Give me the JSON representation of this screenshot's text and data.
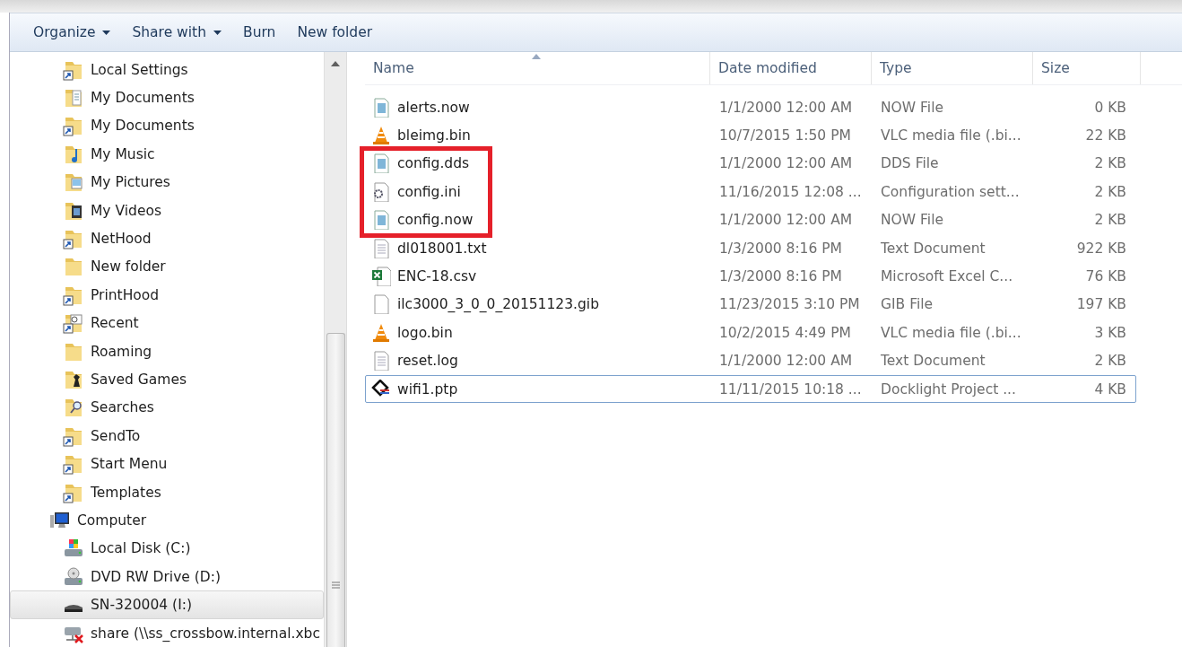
{
  "toolbar": [
    {
      "label": "Organize",
      "dropdown": true
    },
    {
      "label": "Share with",
      "dropdown": true
    },
    {
      "label": "Burn",
      "dropdown": false
    },
    {
      "label": "New folder",
      "dropdown": false
    }
  ],
  "sidebar": {
    "items": [
      {
        "label": "Local Settings",
        "kind": "shortcut",
        "selected": false
      },
      {
        "label": "My Documents",
        "kind": "documents",
        "selected": false
      },
      {
        "label": "My Documents",
        "kind": "shortcut",
        "selected": false
      },
      {
        "label": "My Music",
        "kind": "music",
        "selected": false
      },
      {
        "label": "My Pictures",
        "kind": "pictures",
        "selected": false
      },
      {
        "label": "My Videos",
        "kind": "videos",
        "selected": false
      },
      {
        "label": "NetHood",
        "kind": "shortcut",
        "selected": false
      },
      {
        "label": "New folder",
        "kind": "folder",
        "selected": false
      },
      {
        "label": "PrintHood",
        "kind": "shortcut",
        "selected": false
      },
      {
        "label": "Recent",
        "kind": "recent",
        "selected": false
      },
      {
        "label": "Roaming",
        "kind": "folder",
        "selected": false
      },
      {
        "label": "Saved Games",
        "kind": "games",
        "selected": false
      },
      {
        "label": "Searches",
        "kind": "searches",
        "selected": false
      },
      {
        "label": "SendTo",
        "kind": "shortcut",
        "selected": false
      },
      {
        "label": "Start Menu",
        "kind": "shortcut",
        "selected": false
      },
      {
        "label": "Templates",
        "kind": "shortcut",
        "selected": false
      },
      {
        "label": "Computer",
        "kind": "computer",
        "selected": false,
        "children": [
          {
            "label": "Local Disk (C:)",
            "kind": "disk",
            "selected": false
          },
          {
            "label": "DVD RW Drive (D:)",
            "kind": "dvd",
            "selected": false
          },
          {
            "label": "SN-320004 (I:)",
            "kind": "drive",
            "selected": true
          },
          {
            "label": "share (\\\\ss_crossbow.internal.xbc",
            "kind": "network",
            "selected": false
          }
        ]
      }
    ]
  },
  "table": {
    "columns": [
      {
        "label": "Name",
        "sorted": true
      },
      {
        "label": "Date modified",
        "sorted": false
      },
      {
        "label": "Type",
        "sorted": false
      },
      {
        "label": "Size",
        "sorted": false
      }
    ],
    "rows": [
      {
        "name": "alerts.now",
        "date": "1/1/2000 12:00 AM",
        "type": "NOW File",
        "size": "0 KB",
        "kind": "generic",
        "marked": false,
        "focused": false
      },
      {
        "name": "bleimg.bin",
        "date": "10/7/2015 1:50 PM",
        "type": "VLC media file (.bi...",
        "size": "22 KB",
        "kind": "vlc",
        "marked": false,
        "focused": false
      },
      {
        "name": "config.dds",
        "date": "1/1/2000 12:00 AM",
        "type": "DDS File",
        "size": "2 KB",
        "kind": "generic",
        "marked": true,
        "focused": false
      },
      {
        "name": "config.ini",
        "date": "11/16/2015 12:08 ...",
        "type": "Configuration sett...",
        "size": "2 KB",
        "kind": "settings",
        "marked": true,
        "focused": false
      },
      {
        "name": "config.now",
        "date": "1/1/2000 12:00 AM",
        "type": "NOW File",
        "size": "2 KB",
        "kind": "generic",
        "marked": true,
        "focused": false
      },
      {
        "name": "dl018001.txt",
        "date": "1/3/2000 8:16 PM",
        "type": "Text Document",
        "size": "922 KB",
        "kind": "text",
        "marked": false,
        "focused": false
      },
      {
        "name": "ENC-18.csv",
        "date": "1/3/2000 8:16 PM",
        "type": "Microsoft Excel C...",
        "size": "76 KB",
        "kind": "excel",
        "marked": false,
        "focused": false
      },
      {
        "name": "ilc3000_3_0_0_20151123.gib",
        "date": "11/23/2015 3:10 PM",
        "type": "GIB File",
        "size": "197 KB",
        "kind": "blank",
        "marked": false,
        "focused": false
      },
      {
        "name": "logo.bin",
        "date": "10/2/2015 4:49 PM",
        "type": "VLC media file (.bi...",
        "size": "3 KB",
        "kind": "vlc",
        "marked": false,
        "focused": false
      },
      {
        "name": "reset.log",
        "date": "1/1/2000 12:00 AM",
        "type": "Text Document",
        "size": "2 KB",
        "kind": "text",
        "marked": false,
        "focused": false
      },
      {
        "name": "wifi1.ptp",
        "date": "11/11/2015 10:18 ...",
        "type": "Docklight Project ...",
        "size": "4 KB",
        "kind": "docklight",
        "marked": false,
        "focused": true
      }
    ]
  }
}
